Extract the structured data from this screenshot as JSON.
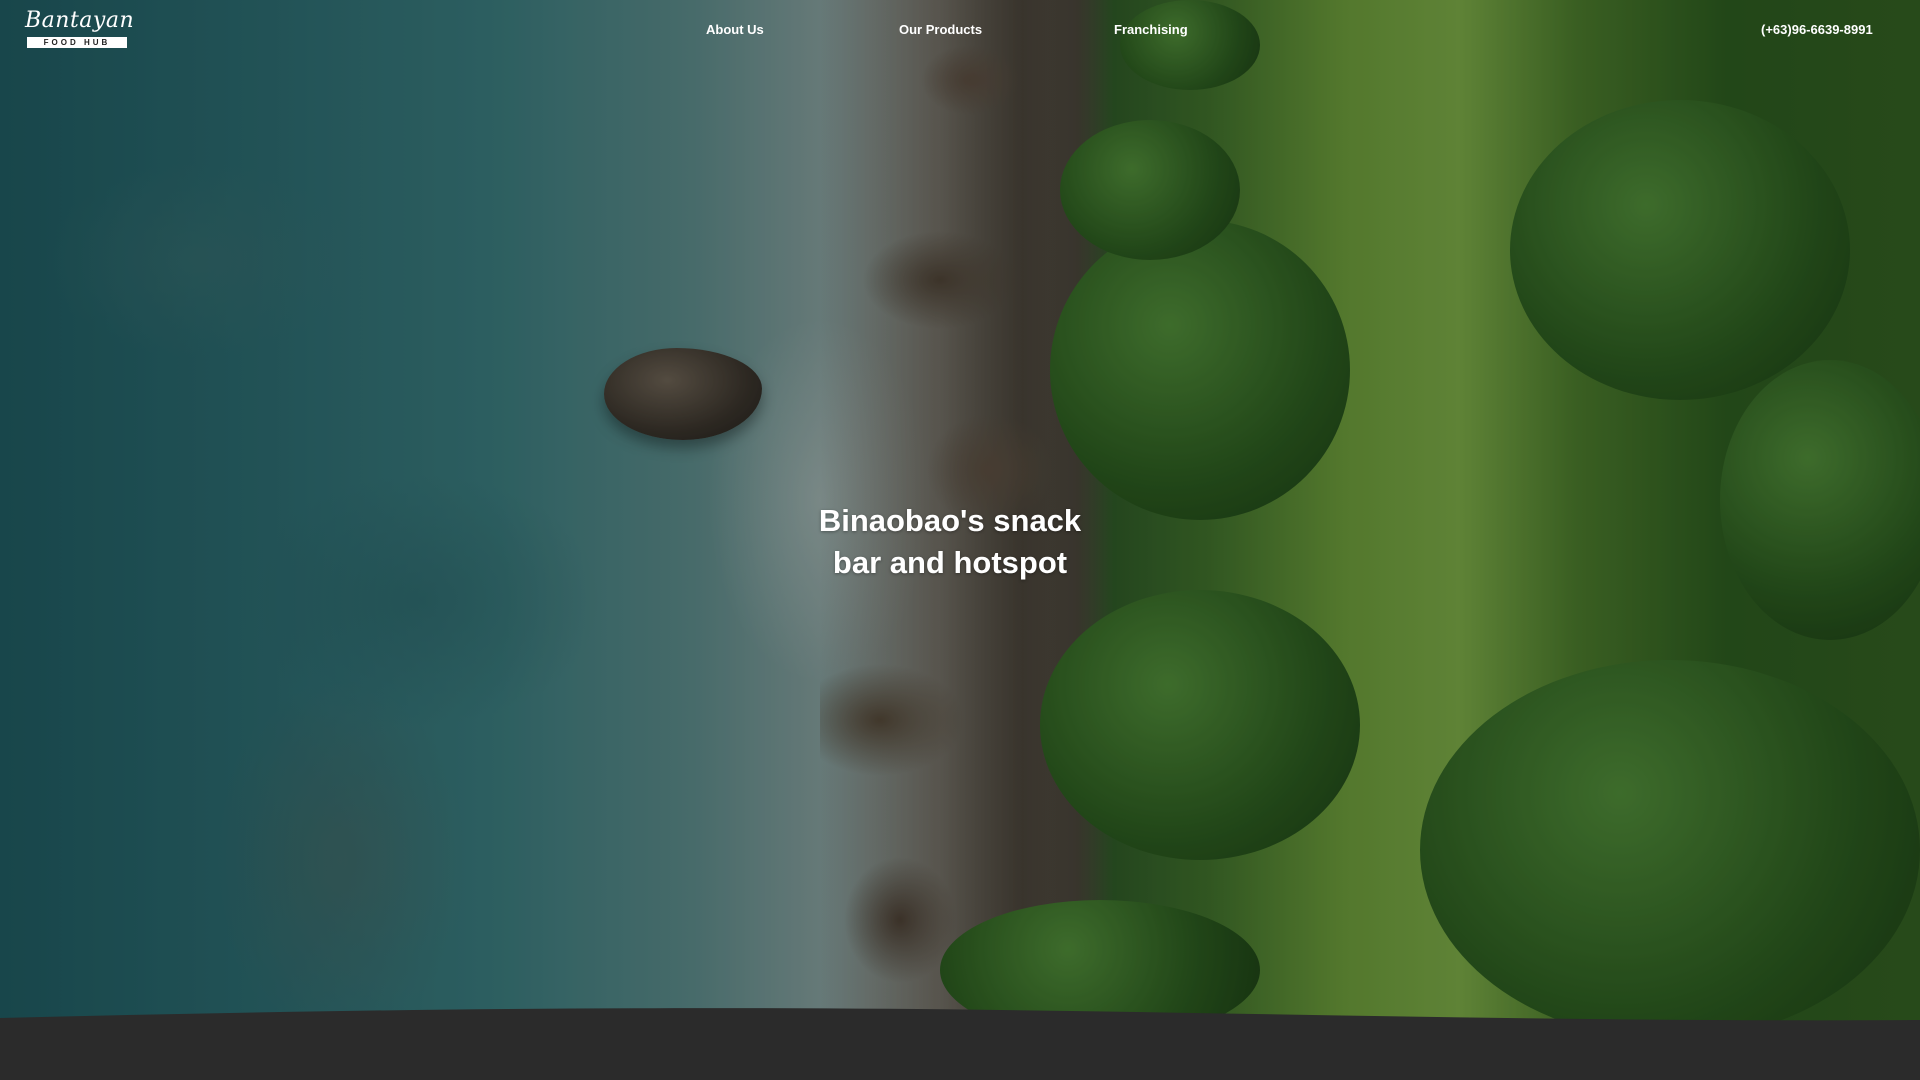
{
  "brand": {
    "name": "Bantayan",
    "tagline": "FOOD HUB"
  },
  "nav": {
    "items": [
      {
        "label": "About Us"
      },
      {
        "label": "Our Products"
      },
      {
        "label": "Franchising"
      }
    ],
    "phone": "(+63)96-6639-8991"
  },
  "hero": {
    "headline_line1": "Binaobao's snack",
    "headline_line2": "bar and hotspot"
  },
  "colors": {
    "text": "#ffffff",
    "footer_band": "#2b2b2b"
  }
}
